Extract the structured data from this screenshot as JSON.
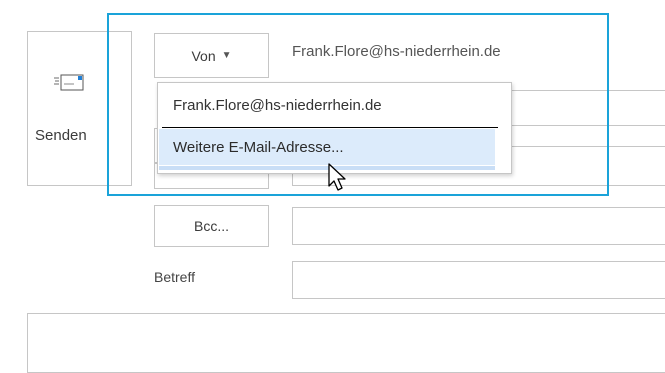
{
  "compose": {
    "send_label": "Senden",
    "from_label": "Von",
    "from_address": "Frank.Flore@hs-niederrhein.de",
    "bcc_label": "Bcc...",
    "subject_label": "Betreff"
  },
  "from_menu": {
    "items": [
      "Frank.Flore@hs-niederrhein.de",
      "Weitere E-Mail-Adresse..."
    ]
  },
  "colors": {
    "highlight": "#1aa3d9",
    "menu_hover": "#dcebfb"
  }
}
